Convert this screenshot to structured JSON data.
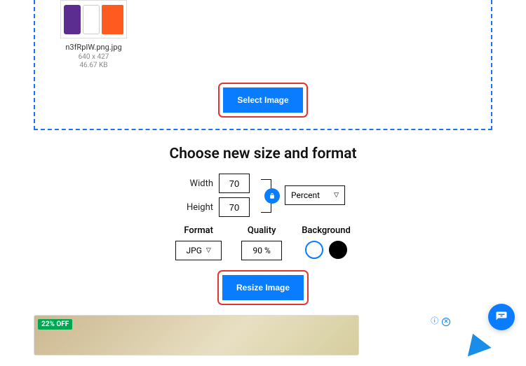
{
  "upload": {
    "filename": "n3fRpIW.png.jpg",
    "dimensions": "640 x 427",
    "filesize": "46.67 KB",
    "select_label": "Select Image"
  },
  "section_title": "Choose new size and format",
  "size": {
    "width_label": "Width",
    "height_label": "Height",
    "width_value": "70",
    "height_value": "70",
    "unit": "Percent"
  },
  "format": {
    "label": "Format",
    "value": "JPG"
  },
  "quality": {
    "label": "Quality",
    "value": "90",
    "suffix": "%"
  },
  "background": {
    "label": "Background"
  },
  "resize_label": "Resize Image",
  "ad": {
    "offer": "22% OFF",
    "info_icon": "ⓘ"
  }
}
